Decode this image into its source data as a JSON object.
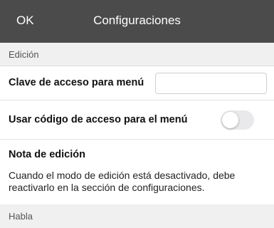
{
  "navbar": {
    "ok_label": "OK",
    "title": "Configuraciones"
  },
  "sections": {
    "edicion": "Edición",
    "habla": "Habla"
  },
  "settings": {
    "menu_password_label": "Clave de acceso para menú",
    "menu_password_value": "",
    "menu_passcode_label": "Usar código de acceso para el menú",
    "menu_passcode_enabled": false,
    "edit_note_title": "Nota de edición",
    "edit_note_text": "Cuando el modo de edición está desactivado, debe reactivarlo en la sección de configuraciones."
  },
  "colors": {
    "navbar": "#4b4b4b",
    "section_bg": "#f0f0f0",
    "toggle_off": "#e9e9eb"
  }
}
